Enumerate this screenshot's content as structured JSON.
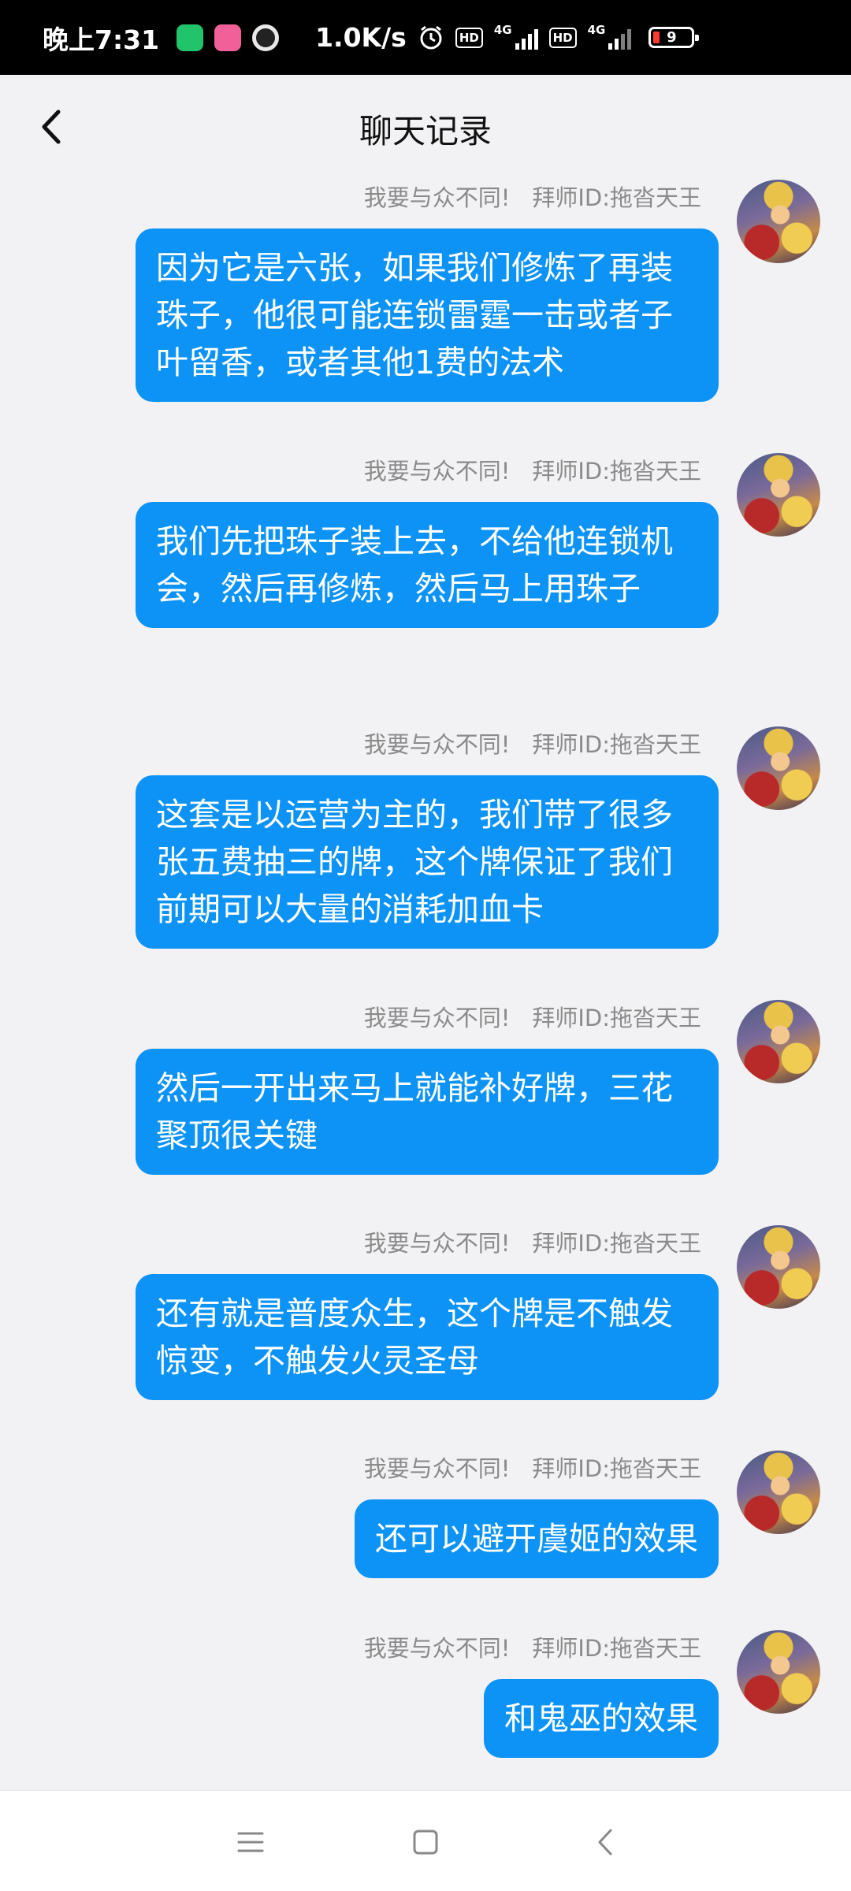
{
  "status_bar": {
    "time": "晚上7:31",
    "net_speed": "1.0K/s",
    "hd1": "HD",
    "hd2": "HD",
    "net1": "4G",
    "net2": "4G",
    "battery": "9"
  },
  "header": {
    "title": "聊天记录",
    "back_icon": "chevron-left-icon"
  },
  "messages": [
    {
      "sender": "我要与众不同!",
      "master_id": "拜师ID:拖沓天王",
      "text": "因为它是六张，如果我们修炼了再装珠子，他很可能连锁雷霆一击或者子叶留香，或者其他1费的法术"
    },
    {
      "sender": "我要与众不同!",
      "master_id": "拜师ID:拖沓天王",
      "text": "我们先把珠子装上去，不给他连锁机会，然后再修炼，然后马上用珠子"
    },
    {
      "sender": "我要与众不同!",
      "master_id": "拜师ID:拖沓天王",
      "text": "这套是以运营为主的，我们带了很多张五费抽三的牌，这个牌保证了我们前期可以大量的消耗加血卡"
    },
    {
      "sender": "我要与众不同!",
      "master_id": "拜师ID:拖沓天王",
      "text": "然后一开出来马上就能补好牌，三花聚顶很关键"
    },
    {
      "sender": "我要与众不同!",
      "master_id": "拜师ID:拖沓天王",
      "text": "还有就是普度众生，这个牌是不触发惊变，不触发火灵圣母"
    },
    {
      "sender": "我要与众不同!",
      "master_id": "拜师ID:拖沓天王",
      "text": "还可以避开虞姬的效果"
    },
    {
      "sender": "我要与众不同!",
      "master_id": "拜师ID:拖沓天王",
      "text": "和鬼巫的效果"
    }
  ],
  "nav_bar": {
    "menu_icon": "menu-icon",
    "home_icon": "home-square-icon",
    "back_icon": "back-triangle-icon"
  },
  "colors": {
    "bubble": "#0d93f5",
    "background": "#f2f2f4",
    "meta_text": "#8a8a8a"
  }
}
